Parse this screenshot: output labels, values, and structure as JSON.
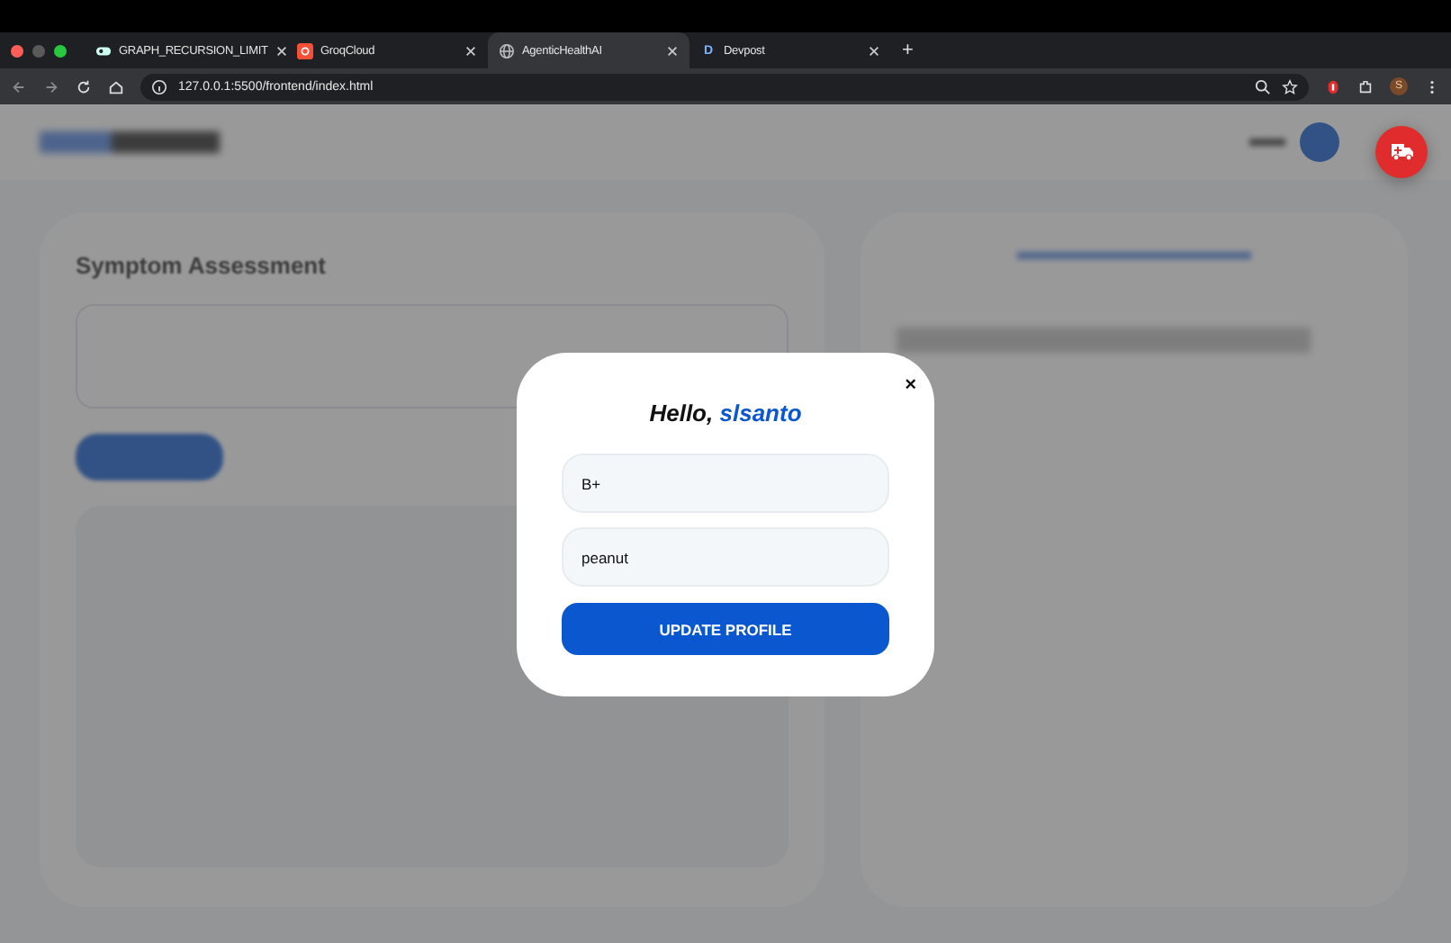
{
  "browser": {
    "tabs": [
      {
        "title": "GRAPH_RECURSION_LIMIT",
        "selected": false,
        "kind": "pill"
      },
      {
        "title": "GroqCloud",
        "selected": false,
        "kind": "orange"
      },
      {
        "title": "AgenticHealthAI",
        "selected": true,
        "kind": "globe"
      },
      {
        "title": "Devpost",
        "selected": false,
        "kind": "letter",
        "favicon_text": "D"
      }
    ],
    "new_tab": "+",
    "address": "127.0.0.1:5500/frontend/index.html",
    "profile_initial": "S"
  },
  "page": {
    "card_title": "Symptom Assessment"
  },
  "modal": {
    "greeting": "Hello,",
    "username": "slsanto",
    "close": "×",
    "fields": [
      {
        "value": "B+"
      },
      {
        "value": "peanut"
      }
    ],
    "button": "UPDATE PROFILE"
  }
}
